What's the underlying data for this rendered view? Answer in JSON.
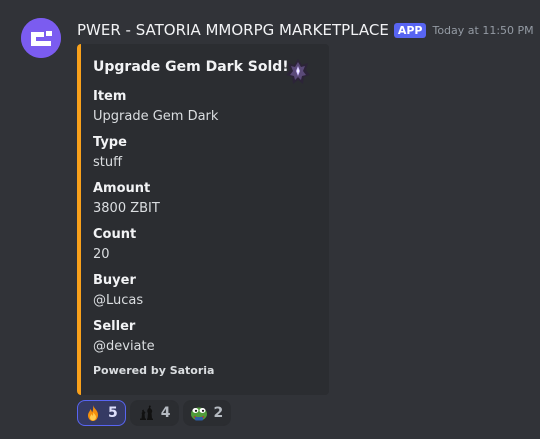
{
  "message": {
    "username": "PWER - SATORIA MMORPG MARKETPLACE",
    "app_tag": "APP",
    "timestamp": "Today at 11:50 PM",
    "avatar": {
      "icon": "bot-logo-icon",
      "color": "#7b5cf0"
    }
  },
  "embed": {
    "accent_color": "#f9a11b",
    "title": "Upgrade Gem Dark Sold!",
    "thumbnail": "dark-gem-icon",
    "fields": [
      {
        "name": "Item",
        "value": "Upgrade Gem Dark"
      },
      {
        "name": "Type",
        "value": "stuff"
      },
      {
        "name": "Amount",
        "value": "3800 ZBIT"
      },
      {
        "name": "Count",
        "value": "20"
      },
      {
        "name": "Buyer",
        "value": "@Lucas"
      },
      {
        "name": "Seller",
        "value": "@deviate"
      }
    ],
    "footer": "Powered by Satoria"
  },
  "reactions": [
    {
      "emoji": "fire-emoji",
      "count": "5",
      "active": true
    },
    {
      "emoji": "chess-pieces-emoji",
      "count": "4",
      "active": false
    },
    {
      "emoji": "pepe-frog-emoji",
      "count": "2",
      "active": false
    }
  ]
}
